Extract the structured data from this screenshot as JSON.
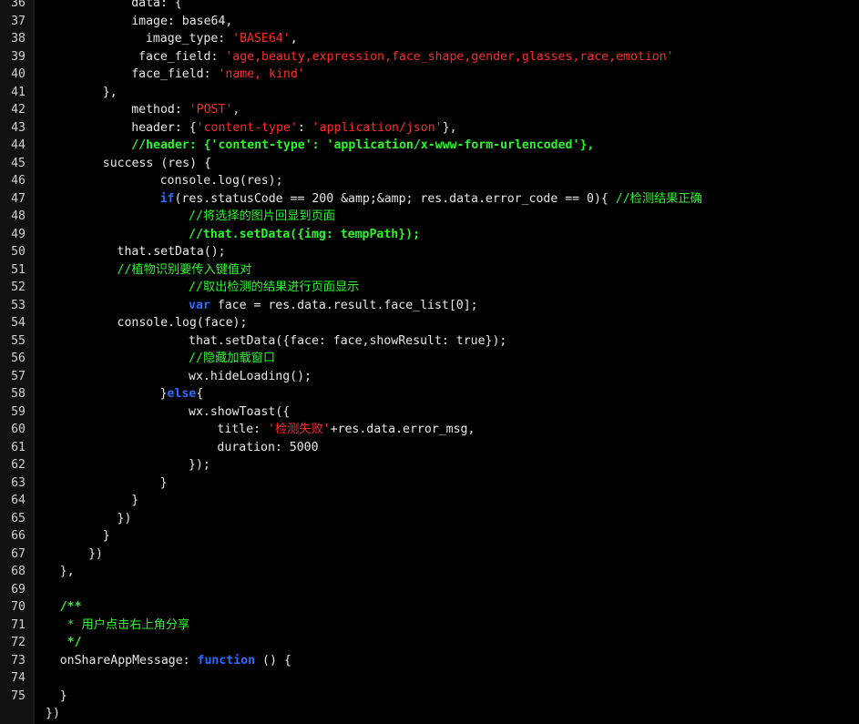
{
  "colors": {
    "background": "#000000",
    "text": "#e8e8e8",
    "string": "#ff2a2a",
    "keyword": "#2b6cff",
    "comment": "#2cf52c",
    "line_number": "#d0d0d0"
  },
  "lines": [
    {
      "n": "36",
      "indent": 6,
      "tokens": [
        {
          "t": "data: {",
          "c": "plain"
        }
      ]
    },
    {
      "n": "37",
      "indent": 6,
      "tokens": [
        {
          "t": "image: base64,",
          "c": "plain"
        }
      ]
    },
    {
      "n": "38",
      "indent": 7,
      "tokens": [
        {
          "t": "image_type: ",
          "c": "plain"
        },
        {
          "t": "'BASE64'",
          "c": "str"
        },
        {
          "t": ",",
          "c": "plain"
        }
      ]
    },
    {
      "n": "39",
      "indent": 6.5,
      "tokens": [
        {
          "t": "face_field: ",
          "c": "plain"
        },
        {
          "t": "'age,beauty,expression,face_shape,gender,glasses,race,emotion'",
          "c": "str"
        }
      ]
    },
    {
      "n": "40",
      "indent": 6,
      "tokens": [
        {
          "t": "face_field: ",
          "c": "plain"
        },
        {
          "t": "'name, kind'",
          "c": "str"
        }
      ]
    },
    {
      "n": "41",
      "indent": 4,
      "tokens": [
        {
          "t": "},",
          "c": "plain"
        }
      ]
    },
    {
      "n": "42",
      "indent": 6,
      "tokens": [
        {
          "t": "method: ",
          "c": "plain"
        },
        {
          "t": "'POST'",
          "c": "str"
        },
        {
          "t": ",",
          "c": "plain"
        }
      ]
    },
    {
      "n": "43",
      "indent": 6,
      "tokens": [
        {
          "t": "header: {",
          "c": "plain"
        },
        {
          "t": "'content-type'",
          "c": "str"
        },
        {
          "t": ": ",
          "c": "plain"
        },
        {
          "t": "'application/json'",
          "c": "str"
        },
        {
          "t": "},",
          "c": "plain"
        }
      ]
    },
    {
      "n": "44",
      "indent": 6,
      "tokens": [
        {
          "t": "//header: {'content-type': 'application/x-www-form-urlencoded'},",
          "c": "cmt-b"
        }
      ]
    },
    {
      "n": "45",
      "indent": 4,
      "tokens": [
        {
          "t": "success (res) {",
          "c": "plain"
        }
      ]
    },
    {
      "n": "46",
      "indent": 8,
      "tokens": [
        {
          "t": "console.log(res);",
          "c": "plain"
        }
      ]
    },
    {
      "n": "47",
      "indent": 8,
      "tokens": [
        {
          "t": "if",
          "c": "kw"
        },
        {
          "t": "(res.statusCode == 200 &amp;&amp; res.data.error_code == 0){ ",
          "c": "plain"
        },
        {
          "t": "//检测结果正确",
          "c": "cmt"
        }
      ]
    },
    {
      "n": "48",
      "indent": 10,
      "tokens": [
        {
          "t": "//将选择的图片回显到页面",
          "c": "cmt"
        }
      ]
    },
    {
      "n": "49",
      "indent": 10,
      "tokens": [
        {
          "t": "//that.setData({img: tempPath});",
          "c": "cmt-b"
        }
      ]
    },
    {
      "n": "50",
      "indent": 5,
      "tokens": [
        {
          "t": "that.setData();",
          "c": "plain"
        }
      ]
    },
    {
      "n": "51",
      "indent": 5,
      "tokens": [
        {
          "t": "//植物识别要传入键值对",
          "c": "cmt"
        }
      ]
    },
    {
      "n": "52",
      "indent": 10,
      "tokens": [
        {
          "t": "//取出检测的结果进行页面显示",
          "c": "cmt"
        }
      ]
    },
    {
      "n": "53",
      "indent": 10,
      "tokens": [
        {
          "t": "var",
          "c": "kw"
        },
        {
          "t": " face = res.data.result.face_list[0];",
          "c": "plain"
        }
      ]
    },
    {
      "n": "54",
      "indent": 5,
      "tokens": [
        {
          "t": "console.log(face);",
          "c": "plain"
        }
      ]
    },
    {
      "n": "55",
      "indent": 10,
      "tokens": [
        {
          "t": "that.setData({face: face,showResult: true});",
          "c": "plain"
        }
      ]
    },
    {
      "n": "56",
      "indent": 10,
      "tokens": [
        {
          "t": "//隐藏加载窗口",
          "c": "cmt"
        }
      ]
    },
    {
      "n": "57",
      "indent": 10,
      "tokens": [
        {
          "t": "wx.hideLoading();",
          "c": "plain"
        }
      ]
    },
    {
      "n": "58",
      "indent": 8,
      "tokens": [
        {
          "t": "}",
          "c": "plain"
        },
        {
          "t": "else",
          "c": "kw"
        },
        {
          "t": "{",
          "c": "plain"
        }
      ]
    },
    {
      "n": "59",
      "indent": 10,
      "tokens": [
        {
          "t": "wx.showToast({",
          "c": "plain"
        }
      ]
    },
    {
      "n": "60",
      "indent": 12,
      "tokens": [
        {
          "t": "title: ",
          "c": "plain"
        },
        {
          "t": "'检测失败'",
          "c": "str"
        },
        {
          "t": "+res.data.error_msg,",
          "c": "plain"
        }
      ]
    },
    {
      "n": "61",
      "indent": 12,
      "tokens": [
        {
          "t": "duration: 5000",
          "c": "plain"
        }
      ]
    },
    {
      "n": "62",
      "indent": 10,
      "tokens": [
        {
          "t": "});",
          "c": "plain"
        }
      ]
    },
    {
      "n": "63",
      "indent": 8,
      "tokens": [
        {
          "t": "}",
          "c": "plain"
        }
      ]
    },
    {
      "n": "64",
      "indent": 6,
      "tokens": [
        {
          "t": "}",
          "c": "plain"
        }
      ]
    },
    {
      "n": "65",
      "indent": 5,
      "tokens": [
        {
          "t": "})",
          "c": "plain"
        }
      ]
    },
    {
      "n": "66",
      "indent": 4,
      "tokens": [
        {
          "t": "}",
          "c": "plain"
        }
      ]
    },
    {
      "n": "67",
      "indent": 3,
      "tokens": [
        {
          "t": "})",
          "c": "plain"
        }
      ]
    },
    {
      "n": "68",
      "indent": 1,
      "tokens": [
        {
          "t": "},",
          "c": "plain"
        }
      ]
    },
    {
      "n": "69",
      "indent": 0,
      "tokens": []
    },
    {
      "n": "70",
      "indent": 1,
      "tokens": [
        {
          "t": "/**",
          "c": "cmt-b"
        }
      ]
    },
    {
      "n": "71",
      "indent": 1,
      "tokens": [
        {
          "t": " * 用户点击右上角分享",
          "c": "cmt"
        }
      ]
    },
    {
      "n": "72",
      "indent": 1,
      "tokens": [
        {
          "t": " */",
          "c": "cmt-b"
        }
      ]
    },
    {
      "n": "73",
      "indent": 1,
      "tokens": [
        {
          "t": "onShareAppMessage: ",
          "c": "plain"
        },
        {
          "t": "function",
          "c": "kw"
        },
        {
          "t": " () {",
          "c": "plain"
        }
      ]
    },
    {
      "n": "74",
      "indent": 0,
      "tokens": []
    },
    {
      "n": "75",
      "indent": 1,
      "tokens": [
        {
          "t": "}",
          "c": "plain"
        }
      ]
    },
    {
      "n": "",
      "indent": 0,
      "tokens": [
        {
          "t": "})",
          "c": "plain"
        }
      ]
    }
  ]
}
